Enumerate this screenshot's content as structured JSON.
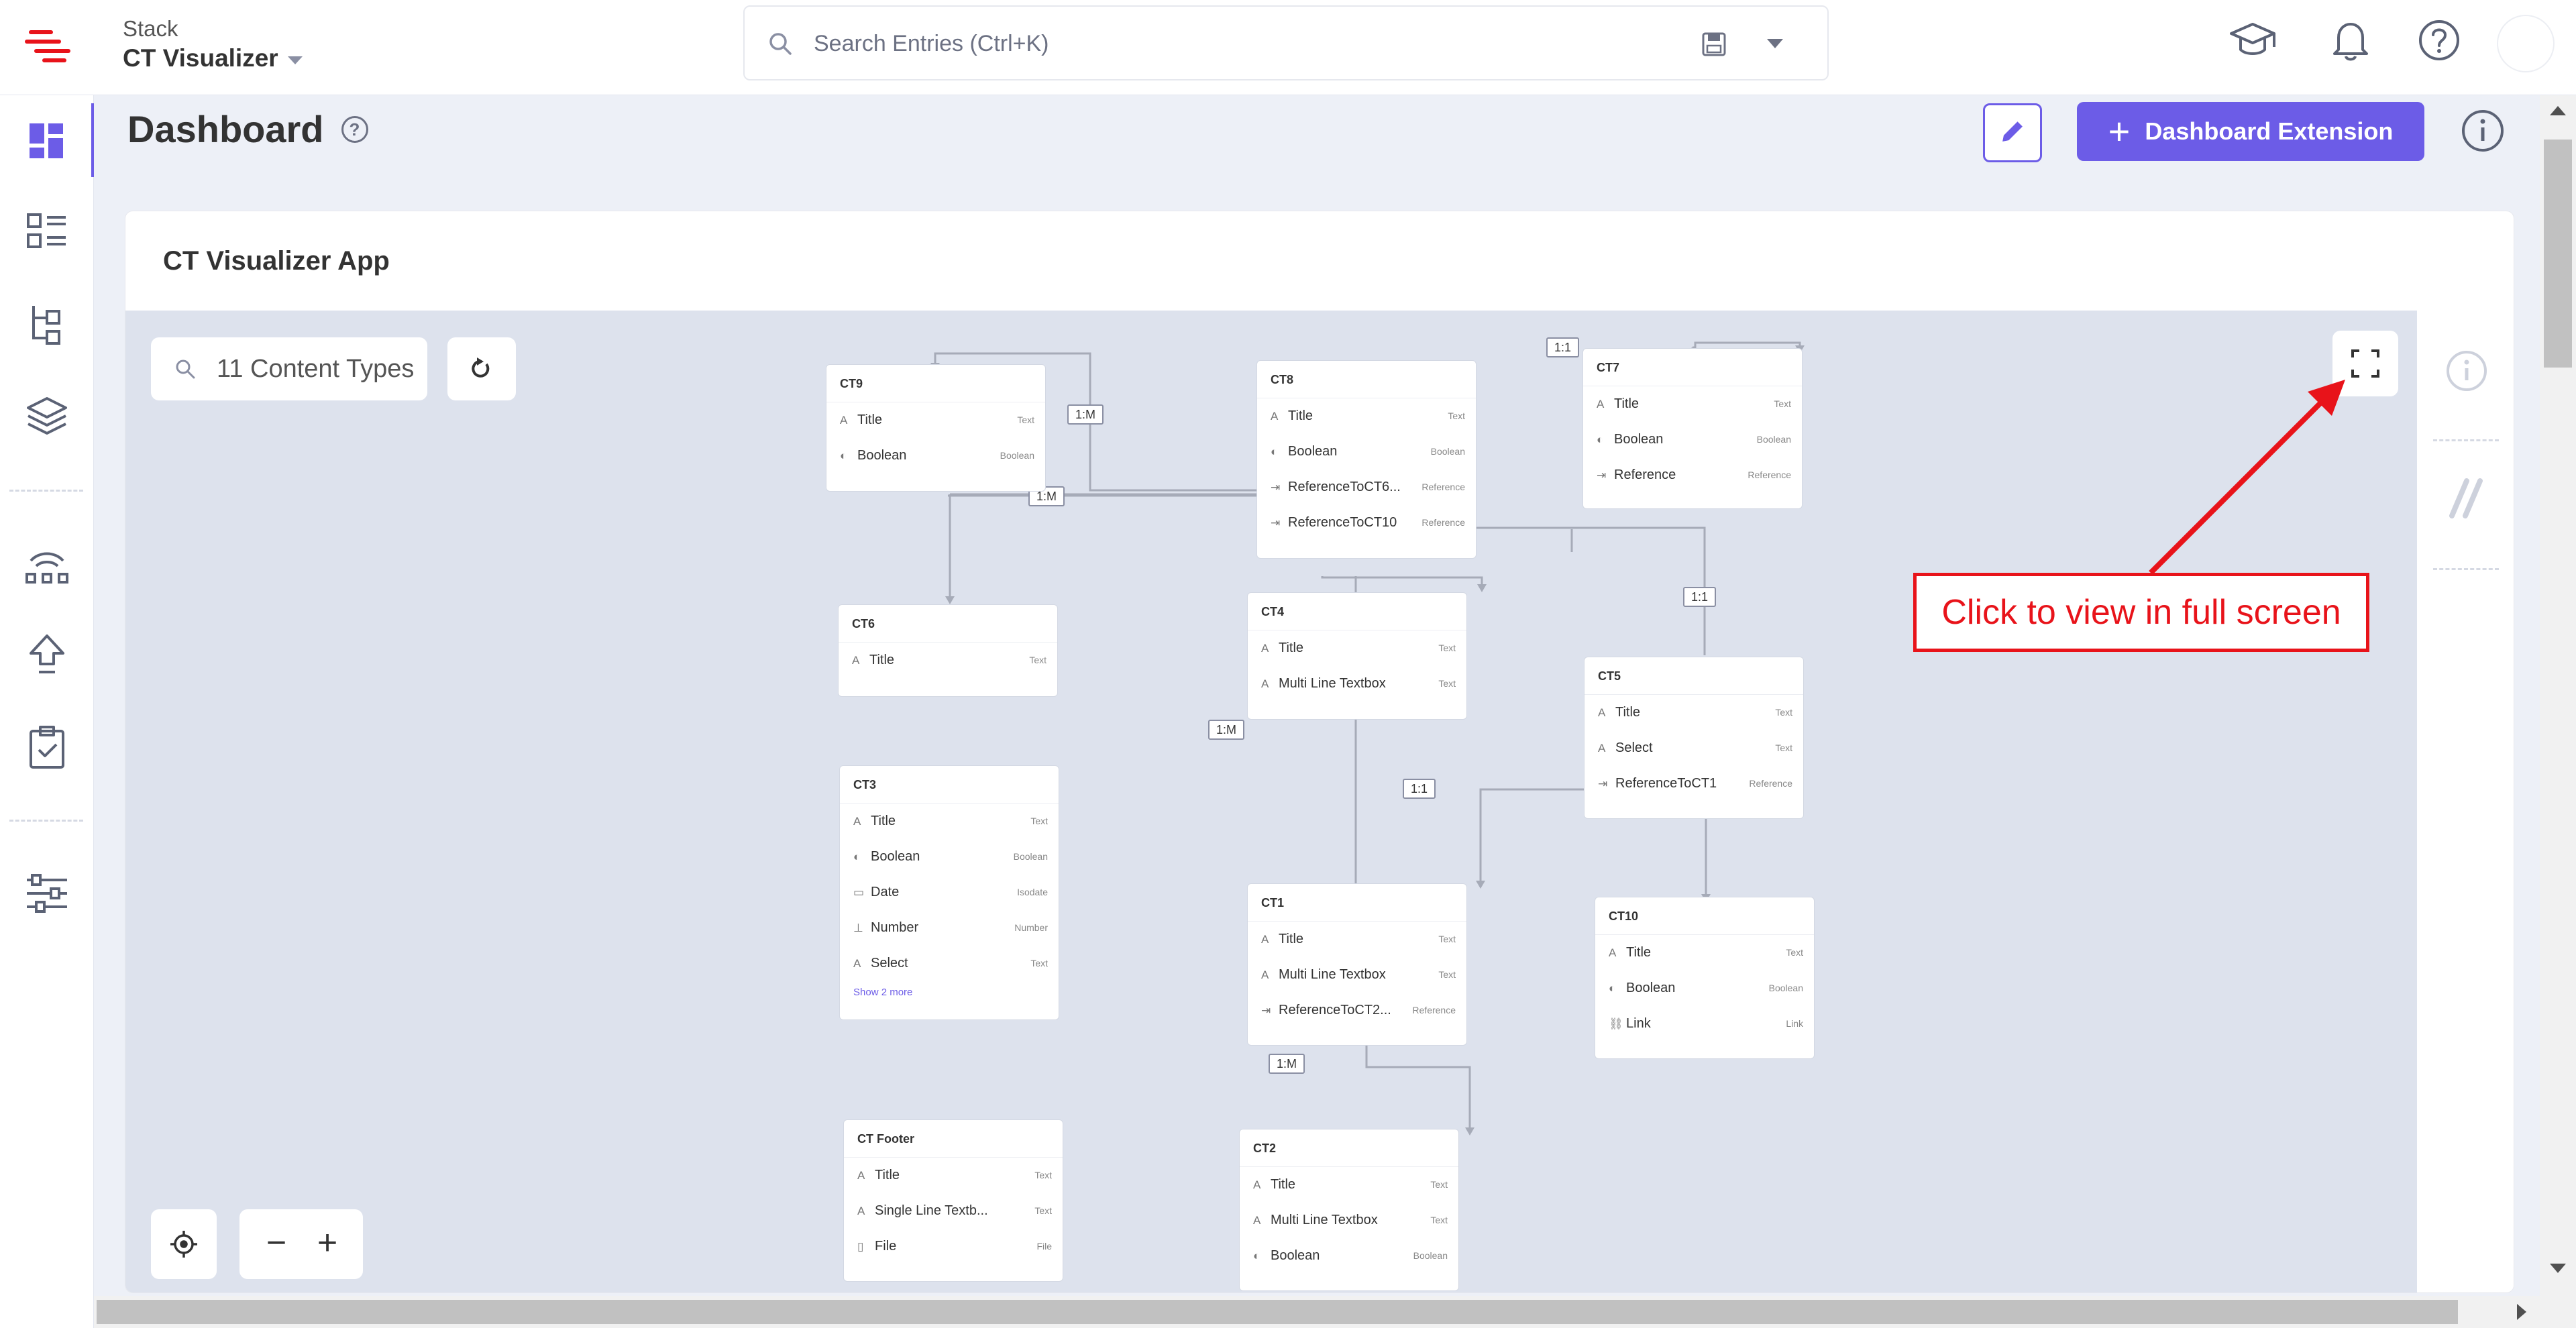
{
  "topbar": {
    "stack_label": "Stack",
    "stack_name": "CT Visualizer",
    "search_placeholder": "Search Entries (Ctrl+K)"
  },
  "dashboard": {
    "title": "Dashboard",
    "extension_button": "Dashboard Extension"
  },
  "panel": {
    "title": "CT Visualizer App",
    "search_label": "11 Content Types",
    "zoom_out": "−",
    "zoom_in": "+"
  },
  "nodes": {
    "ct9": {
      "title": "CT9",
      "fields": [
        {
          "name": "Title",
          "type": "Text"
        },
        {
          "name": "Boolean",
          "type": "Boolean"
        }
      ]
    },
    "ct8": {
      "title": "CT8",
      "fields": [
        {
          "name": "Title",
          "type": "Text"
        },
        {
          "name": "Boolean",
          "type": "Boolean"
        },
        {
          "name": "ReferenceToCT6...",
          "type": "Reference"
        },
        {
          "name": "ReferenceToCT10",
          "type": "Reference"
        }
      ]
    },
    "ct7": {
      "title": "CT7",
      "fields": [
        {
          "name": "Title",
          "type": "Text"
        },
        {
          "name": "Boolean",
          "type": "Boolean"
        },
        {
          "name": "Reference",
          "type": "Reference"
        }
      ]
    },
    "ct6": {
      "title": "CT6",
      "fields": [
        {
          "name": "Title",
          "type": "Text"
        }
      ]
    },
    "ct4": {
      "title": "CT4",
      "fields": [
        {
          "name": "Title",
          "type": "Text"
        },
        {
          "name": "Multi Line Textbox",
          "type": "Text"
        }
      ]
    },
    "ct5": {
      "title": "CT5",
      "fields": [
        {
          "name": "Title",
          "type": "Text"
        },
        {
          "name": "Select",
          "type": "Text"
        },
        {
          "name": "ReferenceToCT1",
          "type": "Reference"
        }
      ]
    },
    "ct3": {
      "title": "CT3",
      "fields": [
        {
          "name": "Title",
          "type": "Text"
        },
        {
          "name": "Boolean",
          "type": "Boolean"
        },
        {
          "name": "Date",
          "type": "Isodate"
        },
        {
          "name": "Number",
          "type": "Number"
        },
        {
          "name": "Select",
          "type": "Text"
        }
      ],
      "more": "Show 2 more"
    },
    "ct1": {
      "title": "CT1",
      "fields": [
        {
          "name": "Title",
          "type": "Text"
        },
        {
          "name": "Multi Line Textbox",
          "type": "Text"
        },
        {
          "name": "ReferenceToCT2...",
          "type": "Reference"
        }
      ]
    },
    "ct10": {
      "title": "CT10",
      "fields": [
        {
          "name": "Title",
          "type": "Text"
        },
        {
          "name": "Boolean",
          "type": "Boolean"
        },
        {
          "name": "Link",
          "type": "Link"
        }
      ]
    },
    "ctfooter": {
      "title": "CT Footer",
      "fields": [
        {
          "name": "Title",
          "type": "Text"
        },
        {
          "name": "Single Line Textb...",
          "type": "Text"
        },
        {
          "name": "File",
          "type": "File"
        }
      ]
    },
    "ct2": {
      "title": "CT2",
      "fields": [
        {
          "name": "Title",
          "type": "Text"
        },
        {
          "name": "Multi Line Textbox",
          "type": "Text"
        },
        {
          "name": "Boolean",
          "type": "Boolean"
        }
      ]
    }
  },
  "relations": {
    "ct8_ct9": "1:M",
    "ct8_ct6": "1:M",
    "ct7_self": "1:1",
    "ct10_ct5": "1:1",
    "ct4_ct1": "1:M",
    "ct5_ct1": "1:1",
    "ct1_ct2": "1:M"
  },
  "annotation": {
    "callout_text": "Click to view in full screen",
    "color": "#e8131a"
  },
  "colors": {
    "accent": "#6c5ce7",
    "canvas": "#dde2ed"
  }
}
